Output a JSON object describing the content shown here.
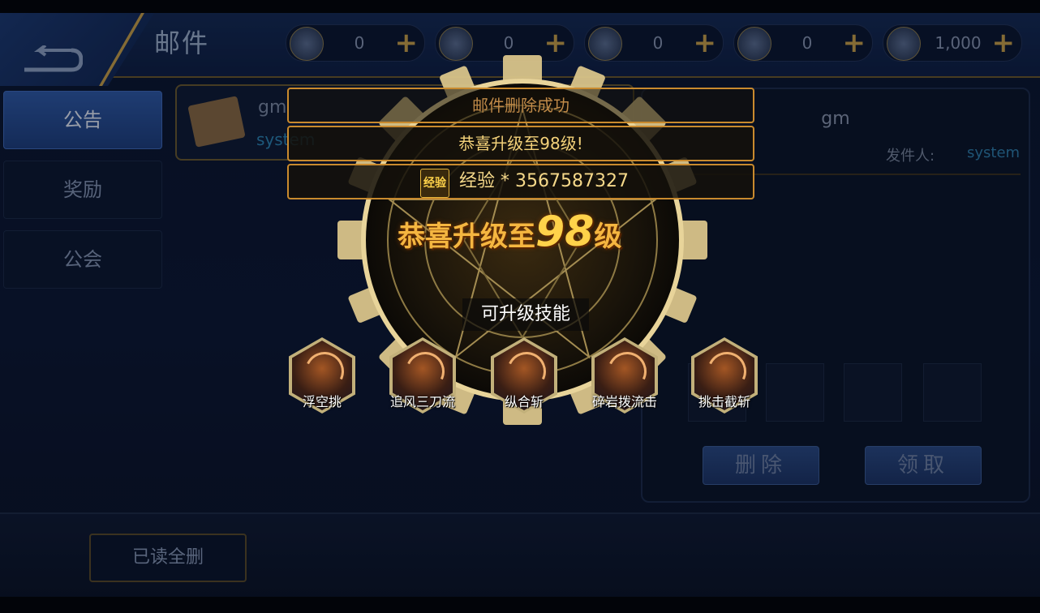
{
  "header": {
    "title": "邮件",
    "currencies": [
      {
        "icon": "gem-coin-icon",
        "value": "0"
      },
      {
        "icon": "scroll-icon",
        "value": "0"
      },
      {
        "icon": "locked-scroll-icon",
        "value": "0"
      },
      {
        "icon": "gold-coin-icon",
        "value": "0"
      },
      {
        "icon": "locked-gold-coin-icon",
        "value": "1,000"
      }
    ],
    "plus_label": "+"
  },
  "sidebar": {
    "tabs": [
      {
        "label": "公告"
      },
      {
        "label": "奖励"
      },
      {
        "label": "公会"
      }
    ]
  },
  "mail_list": {
    "items": [
      {
        "title": "gm",
        "sender": "system"
      }
    ]
  },
  "detail": {
    "title": "gm",
    "sender_label": "发件人:",
    "sender": "system",
    "delete_label": "删除",
    "claim_label": "领取"
  },
  "footer": {
    "delete_read_label": "已读全删"
  },
  "popup": {
    "toasts": [
      "邮件删除成功",
      "恭喜升级至98级!"
    ],
    "exp_icon_text": "经验",
    "exp_text": "经验 * 3567587327",
    "level_prefix": "恭喜升级至",
    "level_number": "98",
    "level_suffix": "级",
    "skills_label": "可升级技能",
    "skills": [
      {
        "name": "浮空挑"
      },
      {
        "name": "追风三刀流"
      },
      {
        "name": "纵合斩"
      },
      {
        "name": "碎岩拨流击"
      },
      {
        "name": "挑击截斩"
      }
    ]
  }
}
